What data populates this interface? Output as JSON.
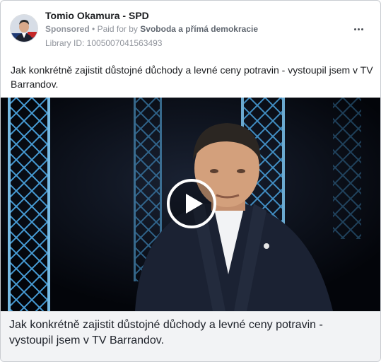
{
  "ad": {
    "page_name": "Tomio Okamura - SPD",
    "sponsored_label": "Sponsored",
    "separator": "•",
    "paid_for_label": "Paid for by",
    "payer": "Svoboda a přímá demokracie",
    "library_id": "Library ID: 1005007041563493",
    "more_icon": "more-horizontal-icon",
    "post_text": "Jak konkrétně zajistit důstojné důchody a levné ceny potravin - vystoupil jsem v TV Barrandov.",
    "video": {
      "play_icon": "play-icon"
    },
    "caption": "Jak konkrétně zajistit důstojné důchody a levné ceny potravin - vystoupil jsem v TV Barrandov."
  },
  "colors": {
    "text_primary": "#1c1e21",
    "text_secondary": "#90949c",
    "caption_background": "#f2f3f5",
    "stage_light": "#4aa3df"
  }
}
